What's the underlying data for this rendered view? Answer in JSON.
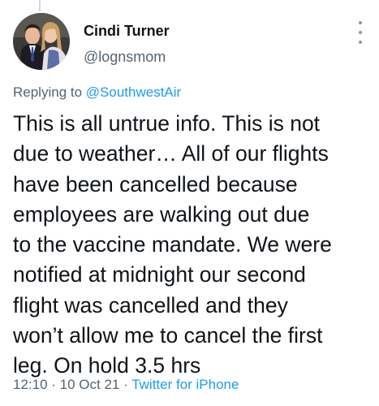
{
  "author": {
    "name": "Cindi Turner",
    "handle": "@lognsmom"
  },
  "reply": {
    "prefix": "Replying to ",
    "handle": "@SouthwestAir"
  },
  "tweet": {
    "lines": [
      "This is all untrue info. This is not",
      "due to weather… All of our flights",
      "have been cancelled because",
      "employees are walking out due",
      "to the vaccine mandate. We were",
      "notified at midnight our second",
      "flight was cancelled and they",
      "won’t allow me to cancel the first",
      "leg. On hold 3.5 hrs"
    ]
  },
  "meta": {
    "time": "12:10",
    "separator": " · ",
    "date": "10 Oct 21",
    "source": "Twitter for iPhone"
  },
  "icons": {
    "more": "more-vertical-icon"
  },
  "colors": {
    "accent": "#1d9bf0",
    "secondary_text": "#536471",
    "primary_text": "#0f1419"
  }
}
